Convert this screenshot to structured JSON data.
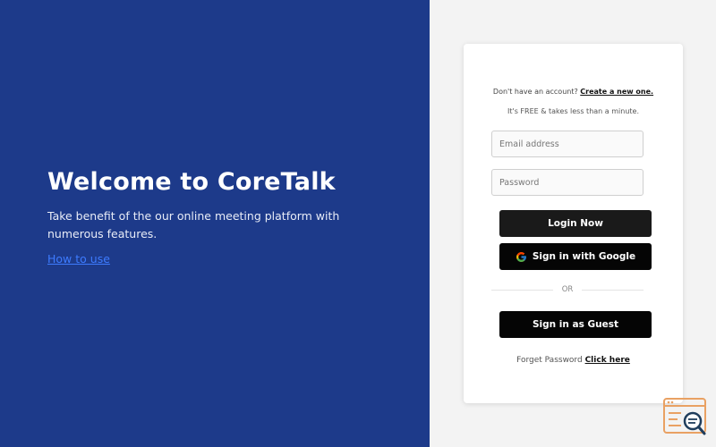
{
  "hero": {
    "title": "Welcome to CoreTalk",
    "subtitle": "Take benefit of the our online meeting platform with numerous features.",
    "link": "How to use"
  },
  "card": {
    "signup_prefix": "Don't have an account?",
    "signup_link": "Create a new one.",
    "free_note": "It's FREE & takes less than a minute.",
    "email_placeholder": "Email address",
    "password_placeholder": "Password",
    "login_label": "Login Now",
    "google_label": "Sign in with Google",
    "or_text": "OR",
    "guest_label": "Sign in as Guest",
    "forget_prefix": "Forget Password",
    "forget_link": "Click here"
  },
  "icons": {
    "google": "google-icon",
    "corner": "search-window-icon"
  },
  "colors": {
    "hero_bg": "#1d3a8a",
    "link": "#3d7bff",
    "button": "#1a1a1a",
    "page_bg": "#f3f3f3",
    "logo_orange": "#e9a163"
  }
}
